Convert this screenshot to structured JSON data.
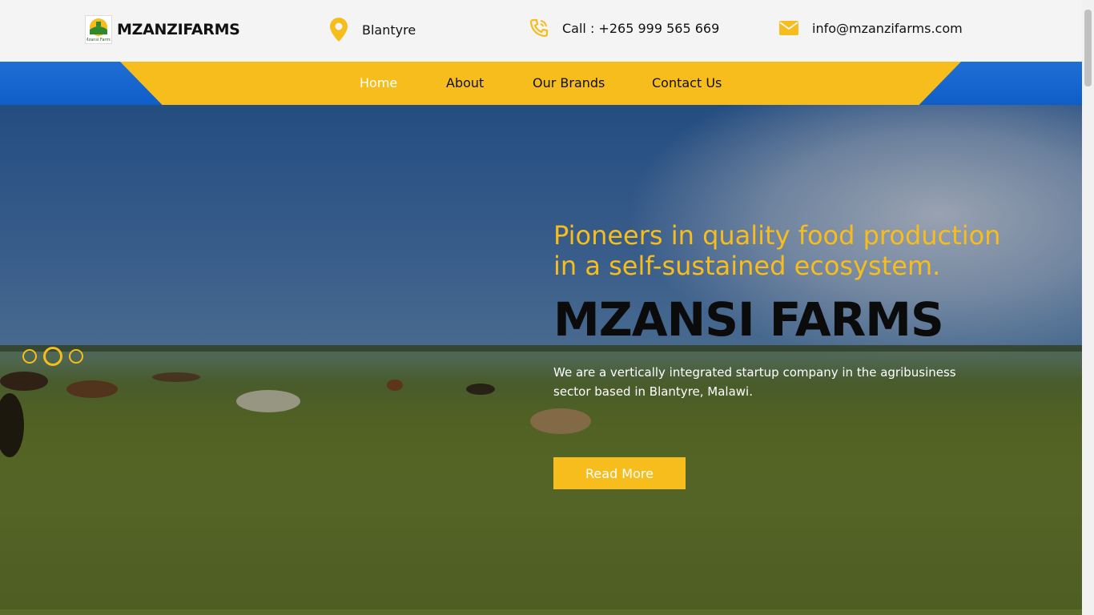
{
  "brand": {
    "name": "MZANZIFARMS",
    "logo_icon": "mzansi-farms-logo",
    "logo_text": "Mzansi Farms"
  },
  "contact": {
    "location": "Blantyre",
    "phone": "Call : +265 999 565 669",
    "email": "info@mzanzifarms.com"
  },
  "nav": {
    "items": [
      {
        "label": "Home",
        "active": true
      },
      {
        "label": "About",
        "active": false
      },
      {
        "label": "Our Brands",
        "active": false
      },
      {
        "label": "Contact Us",
        "active": false
      }
    ]
  },
  "hero": {
    "tagline": "Pioneers in quality food production in a self-sustained ecosystem.",
    "title": "MZANSI FARMS",
    "description": "We are a vertically integrated startup company in the agribusiness sector based in Blantyre, Malawi.",
    "cta_label": "Read More",
    "slides": 3,
    "active_slide": 2
  },
  "colors": {
    "accent": "#f7bd1c",
    "nav_bg": "#1f6fd6",
    "header_bg": "#f4f4f4"
  }
}
